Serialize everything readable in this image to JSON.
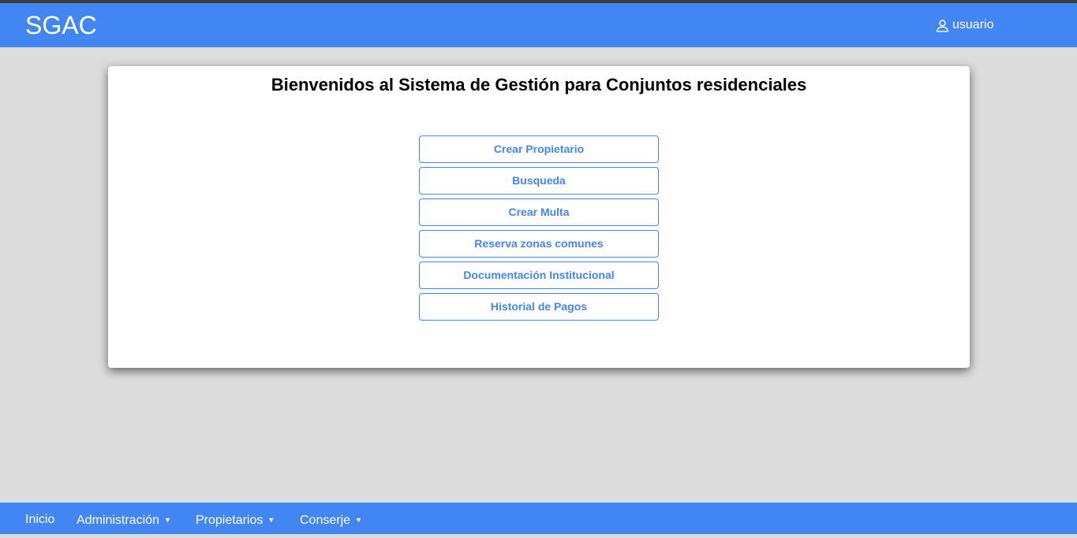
{
  "header": {
    "brand": "SGAC",
    "user_label": "usuario",
    "user_icon": "user-icon"
  },
  "main": {
    "title": "Bienvenidos al Sistema de Gestión para Conjuntos residenciales",
    "buttons": [
      "Crear Propietario",
      "Busqueda",
      "Crear Multa",
      "Reserva zonas comunes",
      "Documentación Institucional",
      "Historial de Pagos"
    ]
  },
  "footer": {
    "nav": [
      {
        "label": "Inicio",
        "dropdown": false
      },
      {
        "label": "Administración",
        "dropdown": true
      },
      {
        "label": "Propietarios",
        "dropdown": true
      },
      {
        "label": "Conserje",
        "dropdown": true
      }
    ],
    "caret_icon": "caret-down-icon"
  },
  "colors": {
    "primary": "#4286f4",
    "background": "#dcdcdc",
    "card": "#ffffff",
    "top_strip": "#3c3c3c"
  }
}
